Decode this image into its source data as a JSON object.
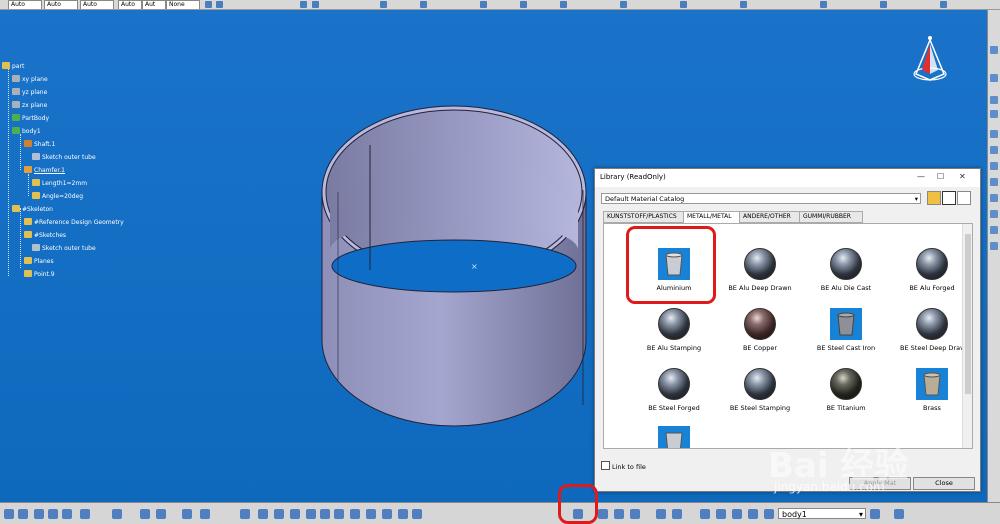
{
  "top_toolbar": {
    "combos": [
      "Auto",
      "Auto",
      "Auto",
      "Auto",
      "Aut",
      "None"
    ]
  },
  "tree": {
    "nodes": [
      {
        "label": "part",
        "icon": "part-icon"
      },
      {
        "label": "xy plane",
        "icon": "plane-icon"
      },
      {
        "label": "yz plane",
        "icon": "plane-icon"
      },
      {
        "label": "zx plane",
        "icon": "plane-icon"
      },
      {
        "label": "PartBody",
        "icon": "body-icon"
      },
      {
        "label": "body1",
        "icon": "body-icon"
      },
      {
        "label": "Shaft.1",
        "icon": "shaft-icon"
      },
      {
        "label": "Sketch outer tube",
        "icon": "sketch-icon"
      },
      {
        "label": "Chamfer.1",
        "icon": "chamfer-icon"
      },
      {
        "label": "Length1=2mm",
        "icon": "parameter-icon"
      },
      {
        "label": "Angle=20deg",
        "icon": "parameter-icon"
      },
      {
        "label": "#Skeleton",
        "icon": "geoset-icon"
      },
      {
        "label": "#Reference Design Geometry",
        "icon": "geoset-icon"
      },
      {
        "label": "#Sketches",
        "icon": "geoset-icon"
      },
      {
        "label": "Sketch outer tube",
        "icon": "sketch-icon"
      },
      {
        "label": "Planes",
        "icon": "geoset-icon"
      },
      {
        "label": "Point.9",
        "icon": "point-icon"
      }
    ]
  },
  "library": {
    "title": "Library (ReadOnly)",
    "catalog": "Default Material Catalog",
    "tabs": [
      "KUNSTSTOFF/PLASTICS",
      "METALL/METAL",
      "ANDERE/OTHER",
      "GUMMI/RUBBER"
    ],
    "active_tab": "METALL/METAL",
    "materials": [
      {
        "name": "Aluminium",
        "kind": "cup"
      },
      {
        "name": "BE Alu Deep Drawn",
        "kind": "sphere"
      },
      {
        "name": "BE Alu Die Cast",
        "kind": "sphere"
      },
      {
        "name": "BE Alu Forged",
        "kind": "sphere"
      },
      {
        "name": "BE Alu Stamping",
        "kind": "sphere"
      },
      {
        "name": "BE Copper",
        "kind": "sphere"
      },
      {
        "name": "BE Steel Cast Iron",
        "kind": "cup"
      },
      {
        "name": "BE Steel Deep Drav",
        "kind": "sphere"
      },
      {
        "name": "BE Steel Forged",
        "kind": "sphere"
      },
      {
        "name": "BE Steel Stamping",
        "kind": "sphere"
      },
      {
        "name": "BE Titanium",
        "kind": "sphere"
      },
      {
        "name": "Brass",
        "kind": "cup"
      }
    ],
    "link_to_file": "Link to file",
    "apply_label": "Apply Mat",
    "close_label": "Close"
  },
  "bottom_toolbar": {
    "body_select": "body1"
  },
  "watermark": {
    "brand": "Bai 经验",
    "url": "jingyan.baidu.com"
  },
  "colors": {
    "viewport": "#0a70c2",
    "highlight": "#e01a1a"
  }
}
